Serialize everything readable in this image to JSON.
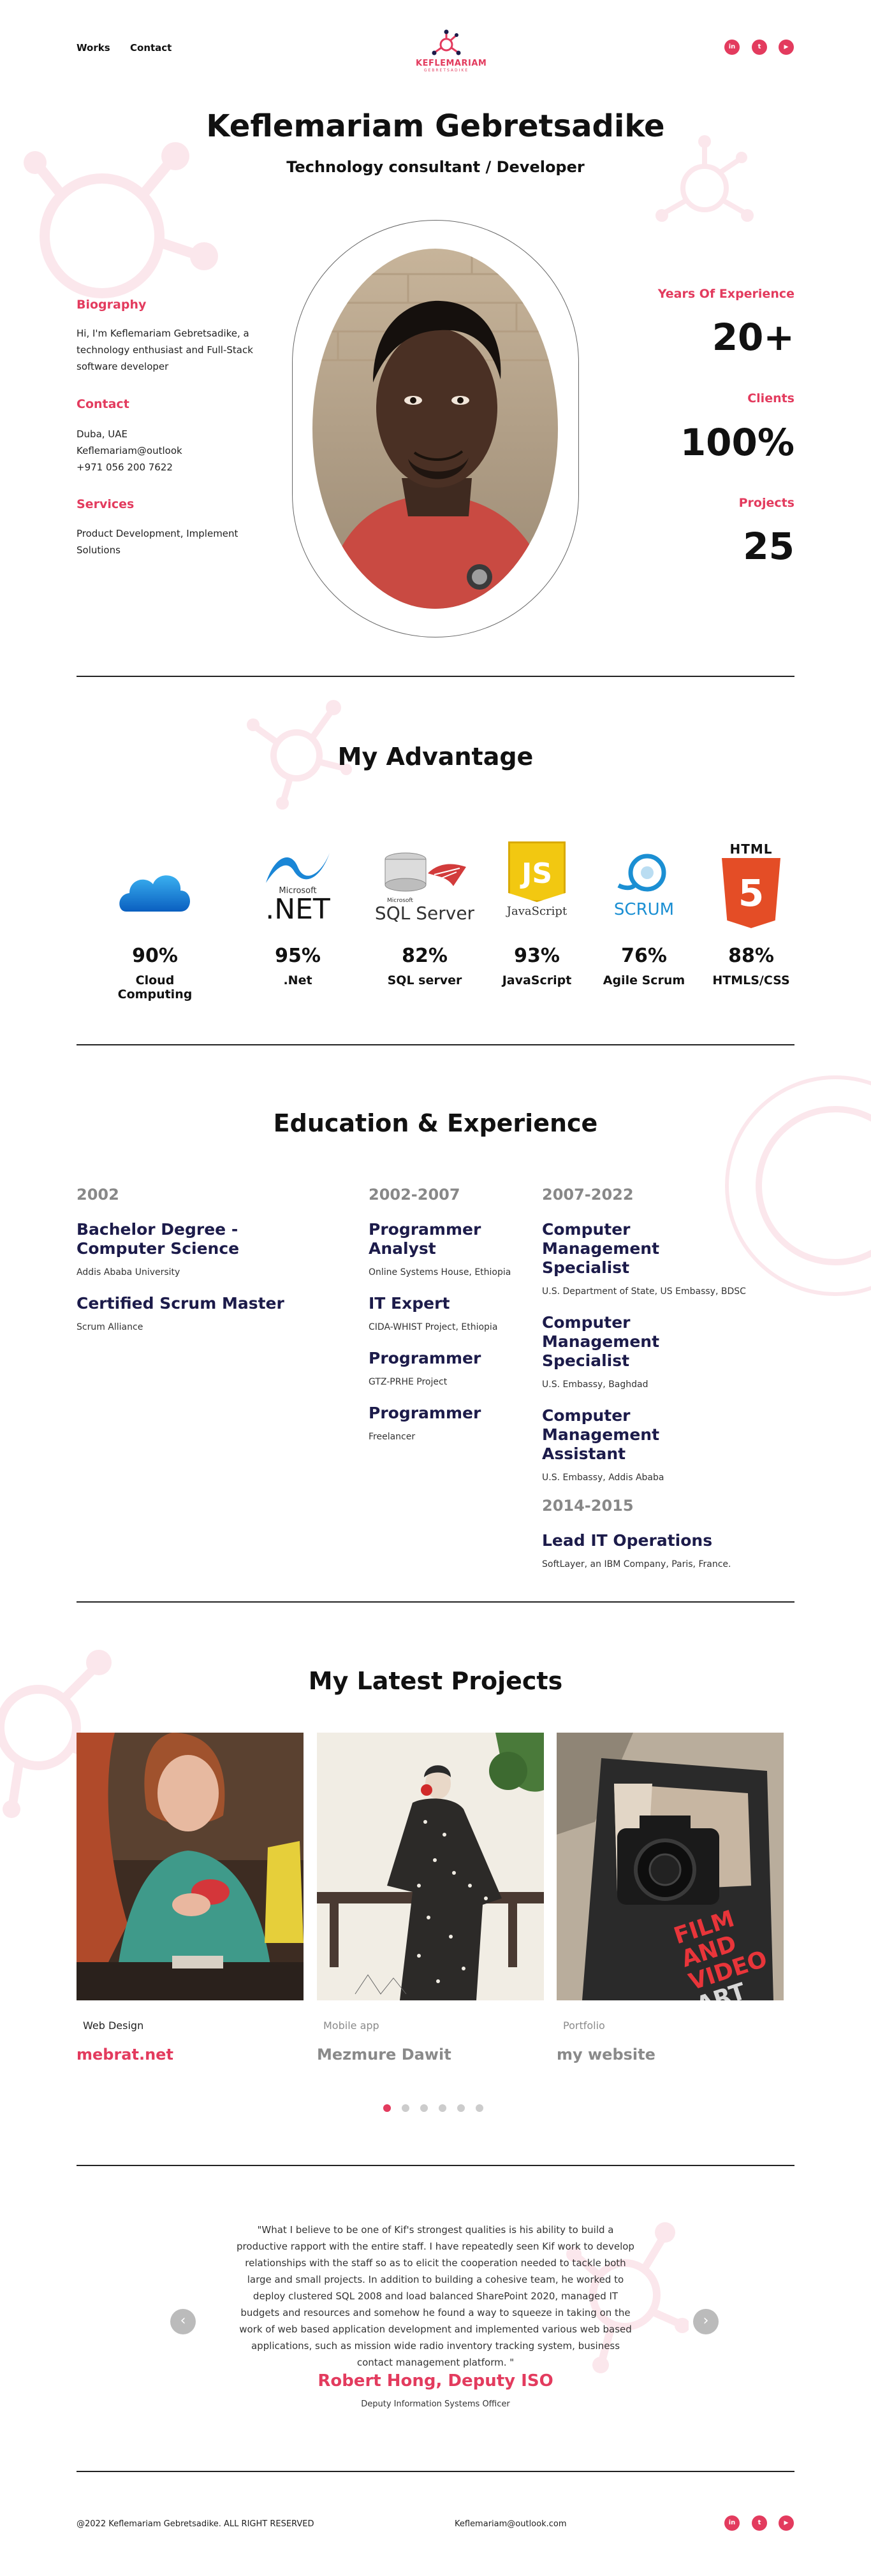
{
  "nav": {
    "works": "Works",
    "contact": "Contact"
  },
  "logo": {
    "name": "KEFLEMARIAM",
    "sub": "GEBRETSADIKE"
  },
  "social": [
    {
      "icon": "linkedin-icon",
      "glyph": "in"
    },
    {
      "icon": "twitter-icon",
      "glyph": "t"
    },
    {
      "icon": "youtube-icon",
      "glyph": "▶"
    }
  ],
  "hero": {
    "name": "Keflemariam Gebretsadike",
    "role": "Technology consultant / Developer",
    "biography_heading": "Biography",
    "biography_text": "Hi, I'm Keflemariam Gebretsadike, a technology enthusiast and Full-Stack software developer",
    "contact_heading": "Contact",
    "contact_lines": [
      "Duba, UAE",
      "Keflemariam@outlook",
      "+971 056 200 7622"
    ],
    "services_heading": "Services",
    "services_text": "Product Development, Implement Solutions",
    "stats": [
      {
        "label": "Years Of Experience",
        "value": "20+"
      },
      {
        "label": "Clients",
        "value": "100%"
      },
      {
        "label": "Projects",
        "value": "25"
      }
    ]
  },
  "advantage": {
    "title": "My Advantage",
    "skills": [
      {
        "name": "Cloud Computing",
        "percent": "90%",
        "icon": "cloud-icon"
      },
      {
        "name": ".Net",
        "percent": "95%",
        "icon": "dotnet-logo",
        "logo_top": "Microsoft",
        "logo_text": ".NET"
      },
      {
        "name": "SQL server",
        "percent": "82%",
        "icon": "sql-server-logo",
        "logo_top": "Microsoft",
        "logo_text": "SQL Server"
      },
      {
        "name": "JavaScript",
        "percent": "93%",
        "icon": "javascript-logo",
        "logo_text": "JavaScript",
        "logo_glyph": "JS"
      },
      {
        "name": "Agile Scrum",
        "percent": "76%",
        "icon": "scrum-logo",
        "logo_text": "SCRUM"
      },
      {
        "name": "HTMLS/CSS",
        "percent": "88%",
        "icon": "html5-logo",
        "logo_top": "HTML",
        "logo_glyph": "5"
      }
    ]
  },
  "education": {
    "title": "Education & Experience",
    "col1": {
      "year": "2002",
      "items": [
        {
          "title": "Bachelor Degree - Computer Science",
          "org": "Addis Ababa University"
        },
        {
          "title": "Certified Scrum Master",
          "org": "Scrum Alliance"
        }
      ]
    },
    "col2": {
      "year": "2002-2007",
      "items": [
        {
          "title": "Programmer Analyst",
          "org": "Online Systems House, Ethiopia"
        },
        {
          "title": "IT Expert",
          "org": "CIDA-WHIST Project, Ethiopia"
        },
        {
          "title": "Programmer",
          "org": "GTZ-PRHE Project"
        },
        {
          "title": "Programmer",
          "org": "Freelancer"
        }
      ]
    },
    "col3": {
      "year": "2007-2022",
      "items": [
        {
          "title": "Computer Management Specialist",
          "org": "U.S. Department of State, US Embassy, BDSC"
        },
        {
          "title": "Computer Management Specialist",
          "org": "U.S. Embassy, Baghdad"
        },
        {
          "title": "Computer Management Assistant",
          "org": "U.S. Embassy, Addis Ababa"
        }
      ],
      "year2": "2014-2015",
      "items2": [
        {
          "title": "Lead IT Operations",
          "org": "SoftLayer, an IBM Company, Paris, France."
        }
      ]
    }
  },
  "projects": {
    "title": "My Latest Projects",
    "items": [
      {
        "category": "Web Design",
        "name": "mebrat.net",
        "color": "#e33b5e"
      },
      {
        "category": "Mobile app",
        "name": "Mezmure Dawit",
        "color": "#8a8a8a"
      },
      {
        "category": "Portfolio",
        "name": "my website",
        "color": "#8a8a8a"
      }
    ],
    "camera_book_text": [
      "FILM",
      "AND",
      "VIDEO",
      "ART"
    ]
  },
  "testimonial": {
    "quote": "\"What I believe to be one of Kif's strongest qualities is his ability to build a productive rapport with the entire staff. I have repeatedly seen Kif work to develop relationships with the staff so as to elicit the cooperation needed to tackle both large and small projects. In addition to building a cohesive team, he worked to deploy clustered SQL 2008 and load balanced SharePoint 2020, managed IT budgets and resources and somehow he found a way to squeeze in taking on the work of web based application development and implemented various web based applications, such as mission wide radio inventory tracking system, business contact management platform. \"",
    "name": "Robert Hong, Deputy ISO",
    "role": "Deputy Information Systems Officer",
    "prev": "‹",
    "next": "›"
  },
  "footer": {
    "copyright": "@2022 Keflemariam Gebretsadike. ALL RIGHT RESERVED",
    "email": "Keflemariam@outlook.com"
  },
  "colors": {
    "accent": "#e33b5e",
    "heading_blue": "#1c1b4a"
  }
}
